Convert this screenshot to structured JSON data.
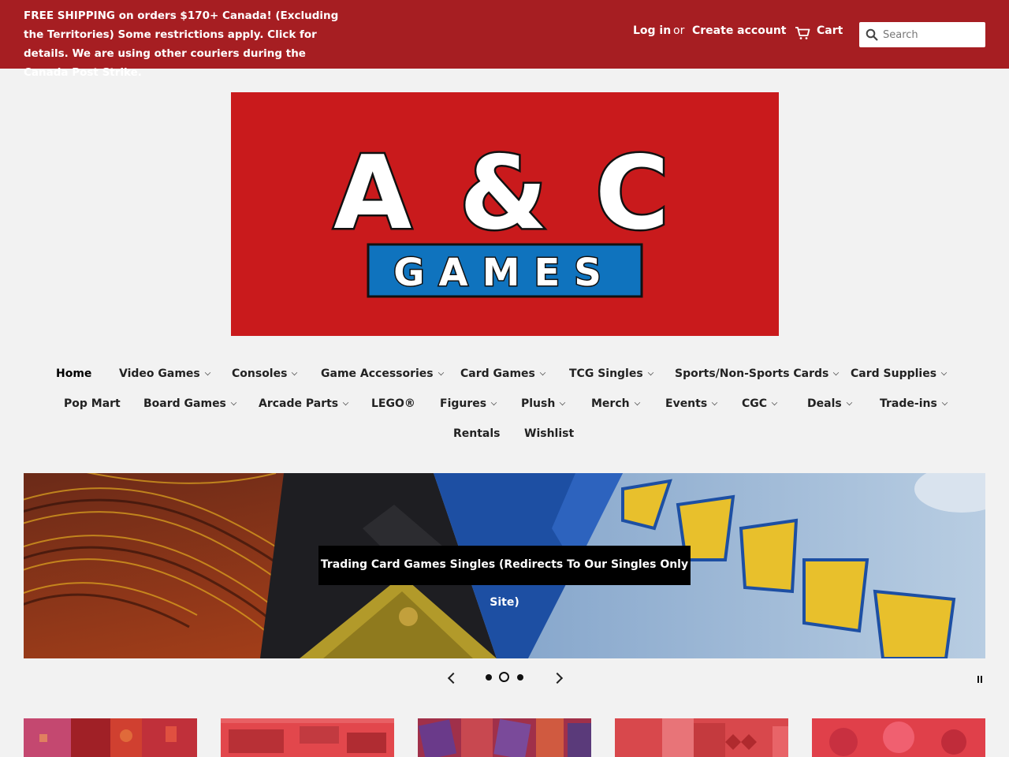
{
  "announcement": "FREE SHIPPING on orders $170+ Canada! (Excluding the Territories) Some restrictions apply. Click for details. We are using other couriers during the Canada Post Strike.",
  "account": {
    "login": "Log in",
    "or": "or",
    "create": "Create account",
    "cart": "Cart"
  },
  "search": {
    "placeholder": "Search"
  },
  "logo": {
    "top_text": "A & C",
    "bottom_text": "GAMES"
  },
  "nav": {
    "row1": [
      "Home",
      "Video Games",
      "Consoles",
      "Game Accessories",
      "Card Games",
      "TCG Singles",
      "Sports/Non-Sports Cards",
      "Card Supplies"
    ],
    "row2": [
      "Pop Mart",
      "Board Games",
      "Arcade Parts",
      "LEGO®",
      "Figures",
      "Plush",
      "Merch",
      "Events",
      "CGC",
      "Deals",
      "Trade-ins"
    ],
    "row3": [
      "Rentals",
      "Wishlist"
    ]
  },
  "slideshow": {
    "caption": "Trading Card Games Singles (Redirects To Our Singles Only Site)",
    "slide_count": 3,
    "active_slide": 2
  },
  "colors": {
    "topbar": "#a61e22",
    "logo_red": "#c91a1c",
    "logo_blue": "#0f73be",
    "background": "#f2f2f2"
  }
}
